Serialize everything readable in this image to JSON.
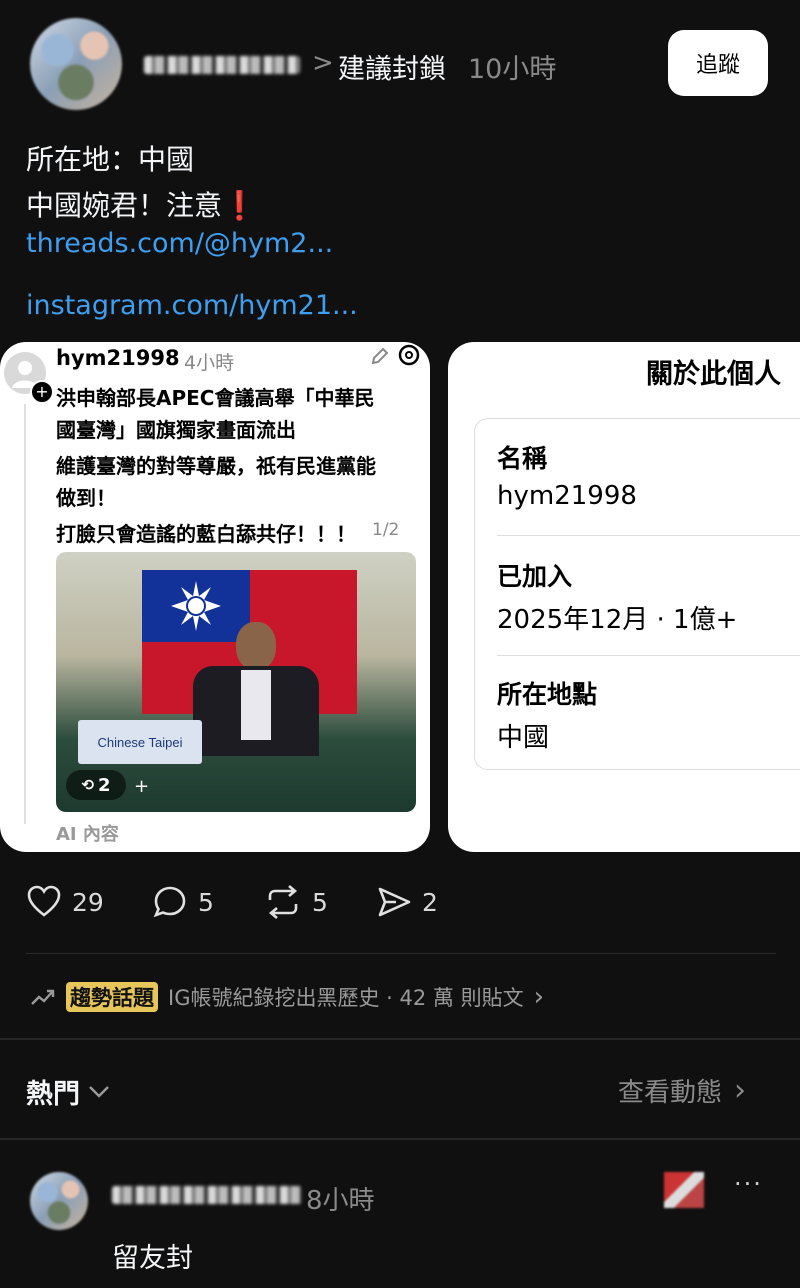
{
  "post": {
    "separator": ">",
    "suggestion": "建議封鎖",
    "time": "10小時",
    "follow_label": "追蹤",
    "lines": [
      "所在地：中國",
      "中國婉君！注意❗"
    ],
    "links": [
      "threads.com/@hym2...",
      "instagram.com/hym21..."
    ]
  },
  "embed_post": {
    "username": "hym21998",
    "time": "4小時",
    "lines": [
      "洪申翰部長APEC會議高舉「中華民",
      "國臺灣」國旗獨家畫面流出",
      "維護臺灣的對等尊嚴，祇有民進黨能",
      "做到！",
      "打臉只會造謠的藍白舔共仔！！！"
    ],
    "page_indicator": "1/2",
    "placard_text": "Chinese Taipei",
    "repost_count": "2",
    "plus": "+",
    "ai_label": "AI 內容"
  },
  "about_card": {
    "title": "關於此個人",
    "name_label": "名稱",
    "name_value": "hym21998",
    "joined_label": "已加入",
    "joined_value": "2025年12月 · 1億+",
    "location_label": "所在地點",
    "location_value": "中國"
  },
  "stats": {
    "likes": "29",
    "comments": "5",
    "reposts": "5",
    "shares": "2"
  },
  "trending": {
    "tag": "趨勢話題",
    "text": "IG帳號紀錄挖出黑歷史 · 42 萬 則貼文",
    "chevron": "›"
  },
  "feed": {
    "sort_label": "熱門",
    "view_activity": "查看動態",
    "chevron": "›"
  },
  "comment": {
    "time": "8小時",
    "text": "留友封",
    "more": "···"
  }
}
